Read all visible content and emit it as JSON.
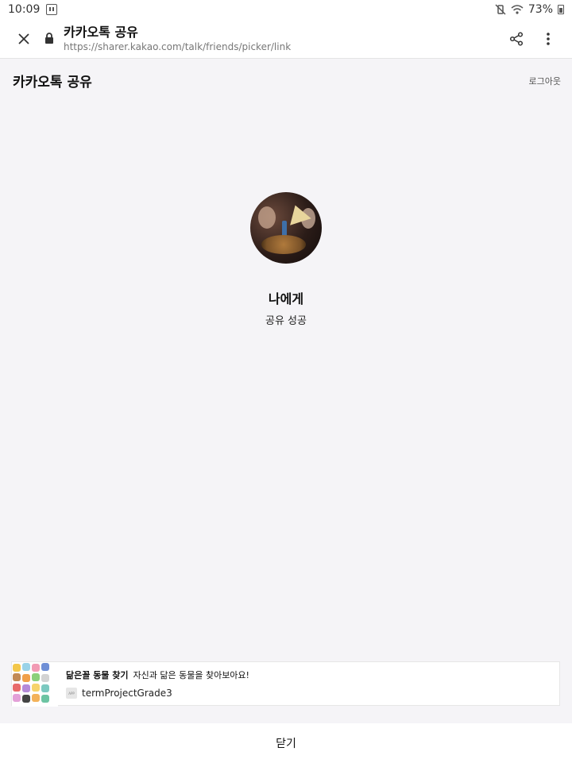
{
  "status_bar": {
    "time": "10:09",
    "battery_text": "73%",
    "icons": [
      "twitch-icon",
      "mute-vibrate-icon",
      "wifi-icon",
      "battery-icon"
    ]
  },
  "browser": {
    "page_title": "카카오톡 공유",
    "url": "https://sharer.kakao.com/talk/friends/picker/link",
    "icons": [
      "close-icon",
      "lock-icon",
      "share-icon",
      "more-vert-icon"
    ]
  },
  "header": {
    "title": "카카오톡 공유",
    "logout_label": "로그아웃"
  },
  "result": {
    "recipient": "나에게",
    "status": "공유 성공"
  },
  "share_card": {
    "title": "닮은꼴 동물 찾기",
    "description": "자신과 닮은 동물을 찾아보아요!",
    "app_name": "termProjectGrade3"
  },
  "footer": {
    "close_label": "닫기"
  },
  "colors": {
    "background": "#f5f4f7",
    "surface": "#ffffff"
  }
}
